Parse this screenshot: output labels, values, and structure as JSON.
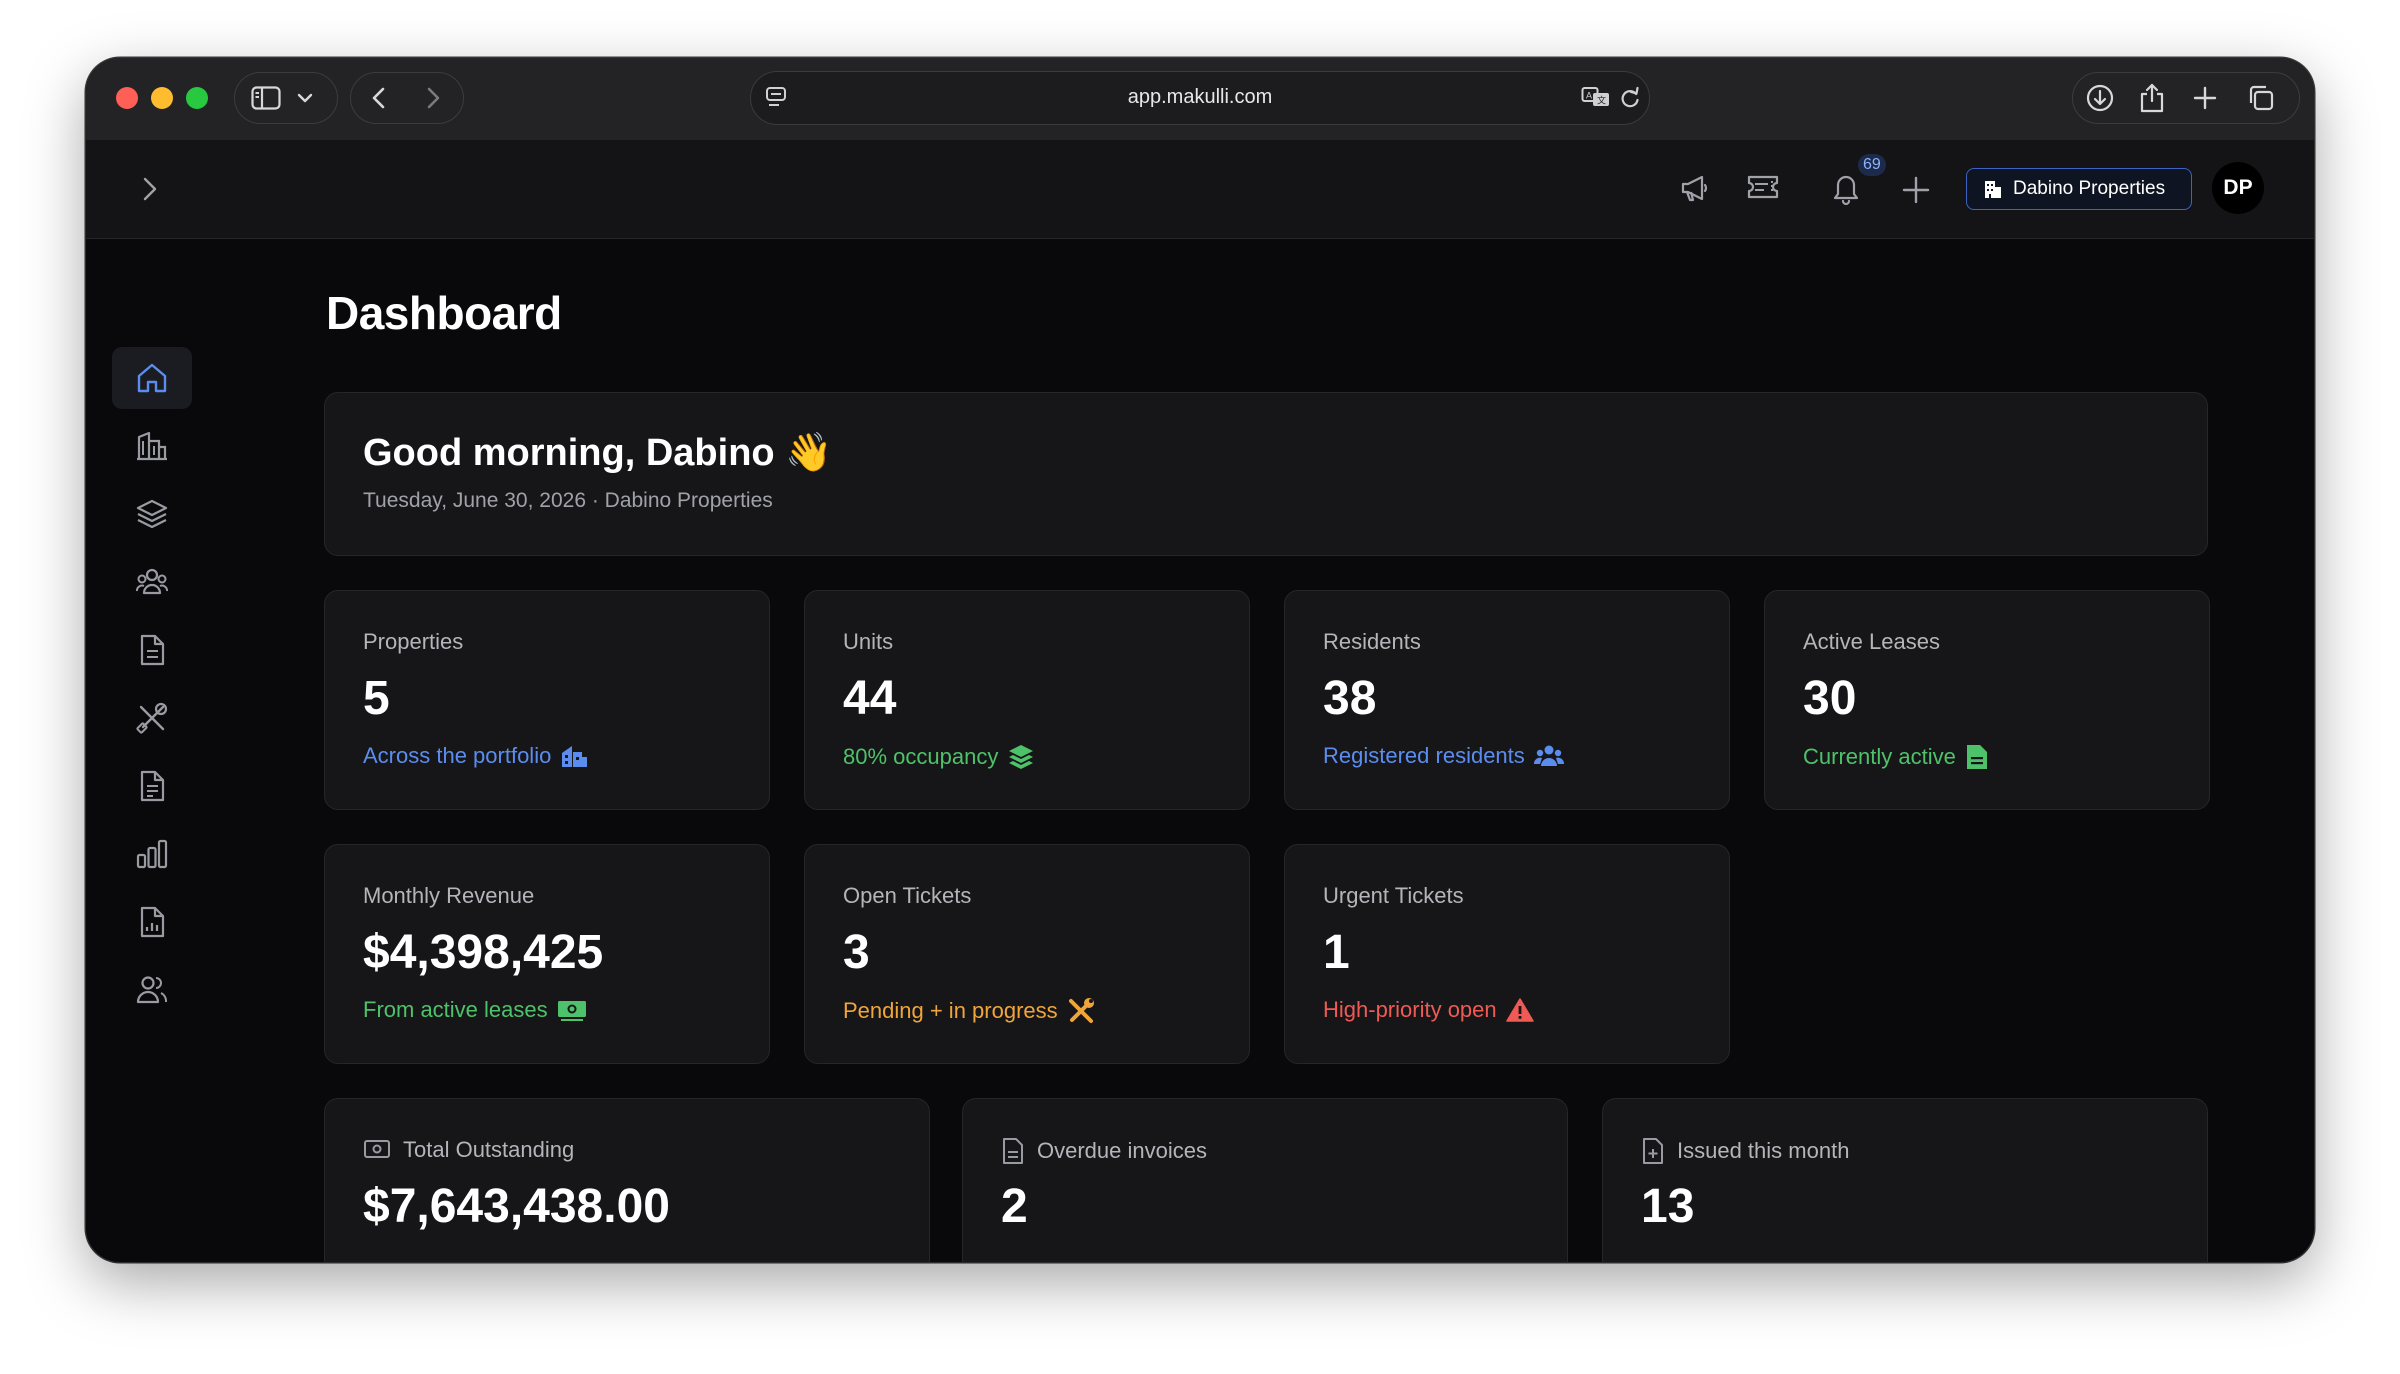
{
  "browser": {
    "url": "app.makulli.com"
  },
  "header": {
    "notification_count": "69",
    "org_name": "Dabino Properties",
    "avatar_initials": "DP"
  },
  "sidebar": {
    "items": [
      {
        "icon": "home-icon",
        "active": true
      },
      {
        "icon": "building-icon"
      },
      {
        "icon": "layers-icon"
      },
      {
        "icon": "residents-icon"
      },
      {
        "icon": "document-icon"
      },
      {
        "icon": "tools-icon"
      },
      {
        "icon": "invoice-icon"
      },
      {
        "icon": "bar-chart-icon"
      },
      {
        "icon": "report-icon"
      },
      {
        "icon": "users-icon"
      }
    ]
  },
  "page": {
    "title": "Dashboard"
  },
  "greeting": {
    "title": "Good morning, Dabino 👋",
    "subtitle": "Tuesday, June 30, 2026 · Dabino Properties"
  },
  "stats": {
    "properties": {
      "label": "Properties",
      "value": "5",
      "note": "Across the portfolio",
      "color": "#5b8def"
    },
    "units": {
      "label": "Units",
      "value": "44",
      "note": "80% occupancy",
      "color": "#4ec26a"
    },
    "residents": {
      "label": "Residents",
      "value": "38",
      "note": "Registered residents",
      "color": "#5b8def"
    },
    "leases": {
      "label": "Active Leases",
      "value": "30",
      "note": "Currently active",
      "color": "#4ec26a"
    },
    "revenue": {
      "label": "Monthly Revenue",
      "value": "$4,398,425",
      "note": "From active leases",
      "color": "#4ec26a"
    },
    "open_tickets": {
      "label": "Open Tickets",
      "value": "3",
      "note": "Pending + in progress",
      "color": "#f0a53a"
    },
    "urgent_tickets": {
      "label": "Urgent Tickets",
      "value": "1",
      "note": "High-priority open",
      "color": "#ef5a55"
    }
  },
  "invoices": {
    "outstanding": {
      "label": "Total Outstanding",
      "value": "$7,643,438.00"
    },
    "overdue": {
      "label": "Overdue invoices",
      "value": "2"
    },
    "issued": {
      "label": "Issued this month",
      "value": "13"
    }
  }
}
